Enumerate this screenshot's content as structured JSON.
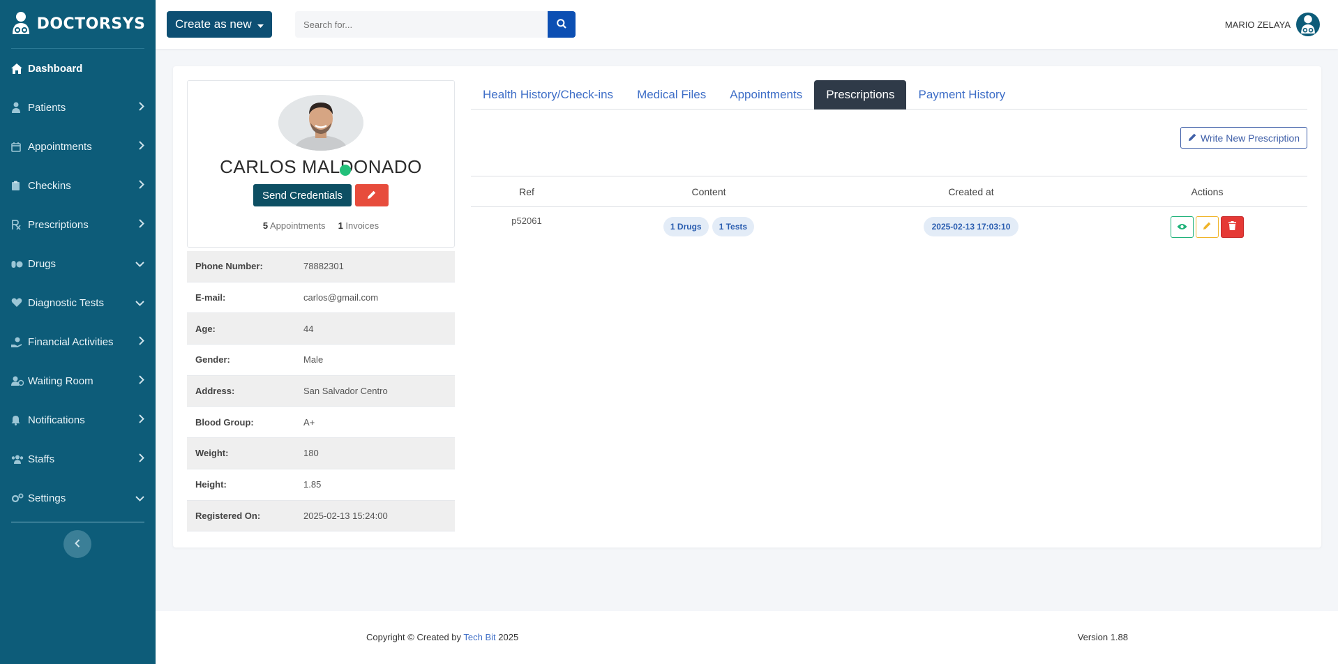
{
  "brand": {
    "name": "DOCTORSYS"
  },
  "sidebar": {
    "items": [
      {
        "label": "Dashboard",
        "icon": "home-icon",
        "chevron": "none",
        "active": true
      },
      {
        "label": "Patients",
        "icon": "user-injured-icon",
        "chevron": "right"
      },
      {
        "label": "Appointments",
        "icon": "calendar-icon",
        "chevron": "right"
      },
      {
        "label": "Checkins",
        "icon": "clipboard-icon",
        "chevron": "right"
      },
      {
        "label": "Prescriptions",
        "icon": "prescription-icon",
        "chevron": "right"
      },
      {
        "label": "Drugs",
        "icon": "pills-icon",
        "chevron": "down"
      },
      {
        "label": "Diagnostic Tests",
        "icon": "heartbeat-icon",
        "chevron": "down"
      },
      {
        "label": "Financial Activities",
        "icon": "hand-holding-usd-icon",
        "chevron": "right"
      },
      {
        "label": "Waiting Room",
        "icon": "user-clock-icon",
        "chevron": "right"
      },
      {
        "label": "Notifications",
        "icon": "bell-icon",
        "chevron": "right"
      },
      {
        "label": "Staffs",
        "icon": "users-icon",
        "chevron": "right"
      },
      {
        "label": "Settings",
        "icon": "cogs-icon",
        "chevron": "down"
      }
    ]
  },
  "topbar": {
    "create_label": "Create as new",
    "search_placeholder": "Search for...",
    "user_name": "MARIO ZELAYA"
  },
  "patient": {
    "name": "CARLOS MALDONADO",
    "send_credentials_label": "Send Credentials",
    "appointments_count": "5",
    "appointments_label": "Appointments",
    "invoices_count": "1",
    "invoices_label": "Invoices",
    "info": [
      {
        "key": "Phone Number:",
        "value": "78882301"
      },
      {
        "key": "E-mail:",
        "value": "carlos@gmail.com"
      },
      {
        "key": "Age:",
        "value": "44"
      },
      {
        "key": "Gender:",
        "value": "Male"
      },
      {
        "key": "Address:",
        "value": "San Salvador Centro"
      },
      {
        "key": "Blood Group:",
        "value": "A+"
      },
      {
        "key": "Weight:",
        "value": "180"
      },
      {
        "key": "Height:",
        "value": "1.85"
      },
      {
        "key": "Registered On:",
        "value": "2025-02-13 15:24:00"
      }
    ]
  },
  "tabs": [
    {
      "label": "Health History/Check-ins",
      "active": false
    },
    {
      "label": "Medical Files",
      "active": false
    },
    {
      "label": "Appointments",
      "active": false
    },
    {
      "label": "Prescriptions",
      "active": true
    },
    {
      "label": "Payment History",
      "active": false
    }
  ],
  "prescriptions": {
    "write_label": "Write New Prescription",
    "columns": [
      "Ref",
      "Content",
      "Created at",
      "Actions"
    ],
    "rows": [
      {
        "ref": "p52061",
        "drugs": "1 Drugs",
        "tests": "1 Tests",
        "created_at": "2025-02-13 17:03:10"
      }
    ]
  },
  "footer": {
    "copy_prefix": "Copyright © Created by",
    "company": "Tech Bit",
    "year": "2025",
    "version": "Version 1.88"
  },
  "colors": {
    "sidebar_bg": "#0d5c79",
    "primary_dark": "#0d4f73",
    "search_btn": "#0c4fb3",
    "active_tab": "#2f3a48",
    "link": "#3e6ec7",
    "danger": "#e74c3c",
    "success": "#20b27a",
    "warning": "#f0b429",
    "online": "#22c07a"
  }
}
